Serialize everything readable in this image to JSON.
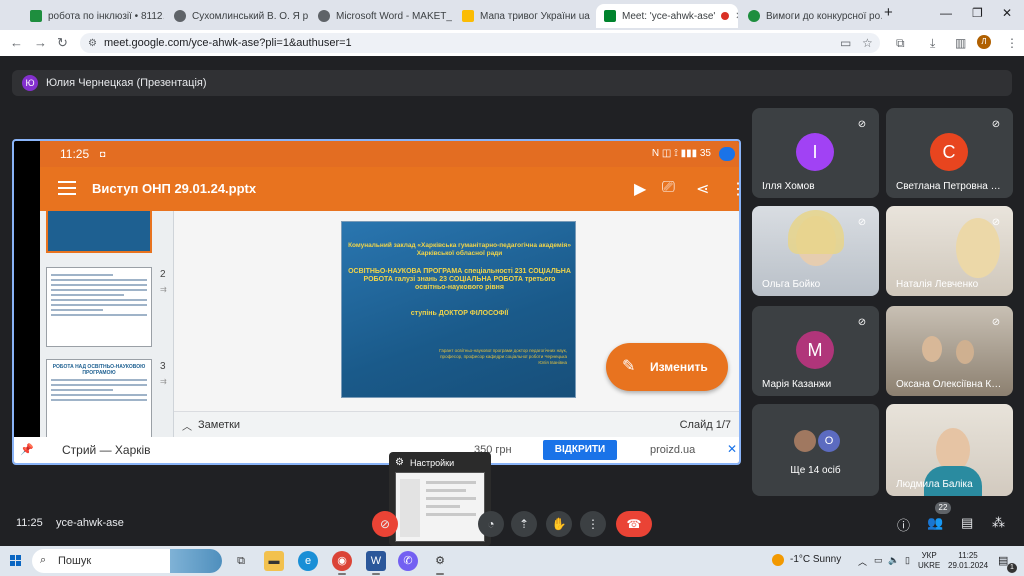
{
  "browser": {
    "tabs": [
      {
        "title": "робота по інклюзії • 8112…",
        "color": "#1e8e3e"
      },
      {
        "title": "Сухомлинський В. О. Я р…",
        "color": "#5f6368"
      },
      {
        "title": "Microsoft Word - MAKET_…",
        "color": "#5f6368"
      },
      {
        "title": "Мапа тривог України ua",
        "color": "#fbbc04"
      },
      {
        "title": "Meet: 'yce-ahwk-ase'",
        "color": "#00832d"
      },
      {
        "title": "Вимоги до конкурсної ро…",
        "color": "#1e8e3e"
      }
    ],
    "url": "meet.google.com/yce-ahwk-ase?pli=1&authuser=1",
    "profile_initial": "Л"
  },
  "presenter": {
    "initial": "Ю",
    "label": "Юлия Чернецкая (Презентація)"
  },
  "phone": {
    "time": "11:25",
    "battery": "35",
    "file_title": "Виступ ОНП 29.01.24.pptx",
    "thumbnails": [
      {
        "num": "2"
      },
      {
        "num": "3"
      }
    ],
    "thumb_title": "РОБОТА НАД ОСВІТНЬО-НАУКОВОЮ ПРОГРАМОЮ",
    "slide": {
      "line1": "Комунальний заклад «Харківська гуманітарно-педагогічна академія» Харківської обласної ради",
      "line2": "ОСВІТНЬО-НАУКОВА ПРОГРАМА спеціальності 231 СОЦІАЛЬНА РОБОТА галузі знань 23 СОЦІАЛЬНА РОБОТА третього освітньо-наукового рівня",
      "line3": "ступінь ДОКТОР ФІЛОСОФІЇ",
      "footer": "Гарант освітньо-наукової програми доктор педагогічних наук, професор, професор кафедри соціальної роботи Чернецька Юлія Іванівна"
    },
    "edit_button": "Изменить",
    "notes_label": "Заметки",
    "slide_counter": "Слайд 1/7",
    "ad": {
      "left_text": "Стрий — Харків",
      "price": "350 грн",
      "button": "ВІДКРИТИ",
      "site": "proizd.ua"
    }
  },
  "participants": [
    {
      "name": "Ілля Хомов",
      "initial": "І",
      "color": "#a142f4",
      "video": false
    },
    {
      "name": "Светлана Петровна …",
      "initial": "С",
      "color": "#e8451f",
      "video": false
    },
    {
      "name": "Ольга Бойко",
      "video": true
    },
    {
      "name": "Наталія Левченко",
      "video": true
    },
    {
      "name": "Марія Казанжи",
      "initial": "М",
      "color": "#b0357a",
      "video": false
    },
    {
      "name": "Оксана Олексіївна К…",
      "video": true
    },
    {
      "name": "Ще 14 осіб",
      "initial": "О",
      "color": "#5c6bc0",
      "video": false
    },
    {
      "name": "Людмила Баліка",
      "video": true
    }
  ],
  "popup": {
    "title": "Настройки"
  },
  "controls": {
    "time": "11:25",
    "meeting_code": "yce-ahwk-ase",
    "participant_count": "22"
  },
  "taskbar": {
    "search_placeholder": "Пошук",
    "weather": "-1°C  Sunny",
    "lang_top": "УКР",
    "lang_bottom": "UKRE",
    "clock_time": "11:25",
    "clock_date": "29.01.2024",
    "notification_count": "1"
  }
}
